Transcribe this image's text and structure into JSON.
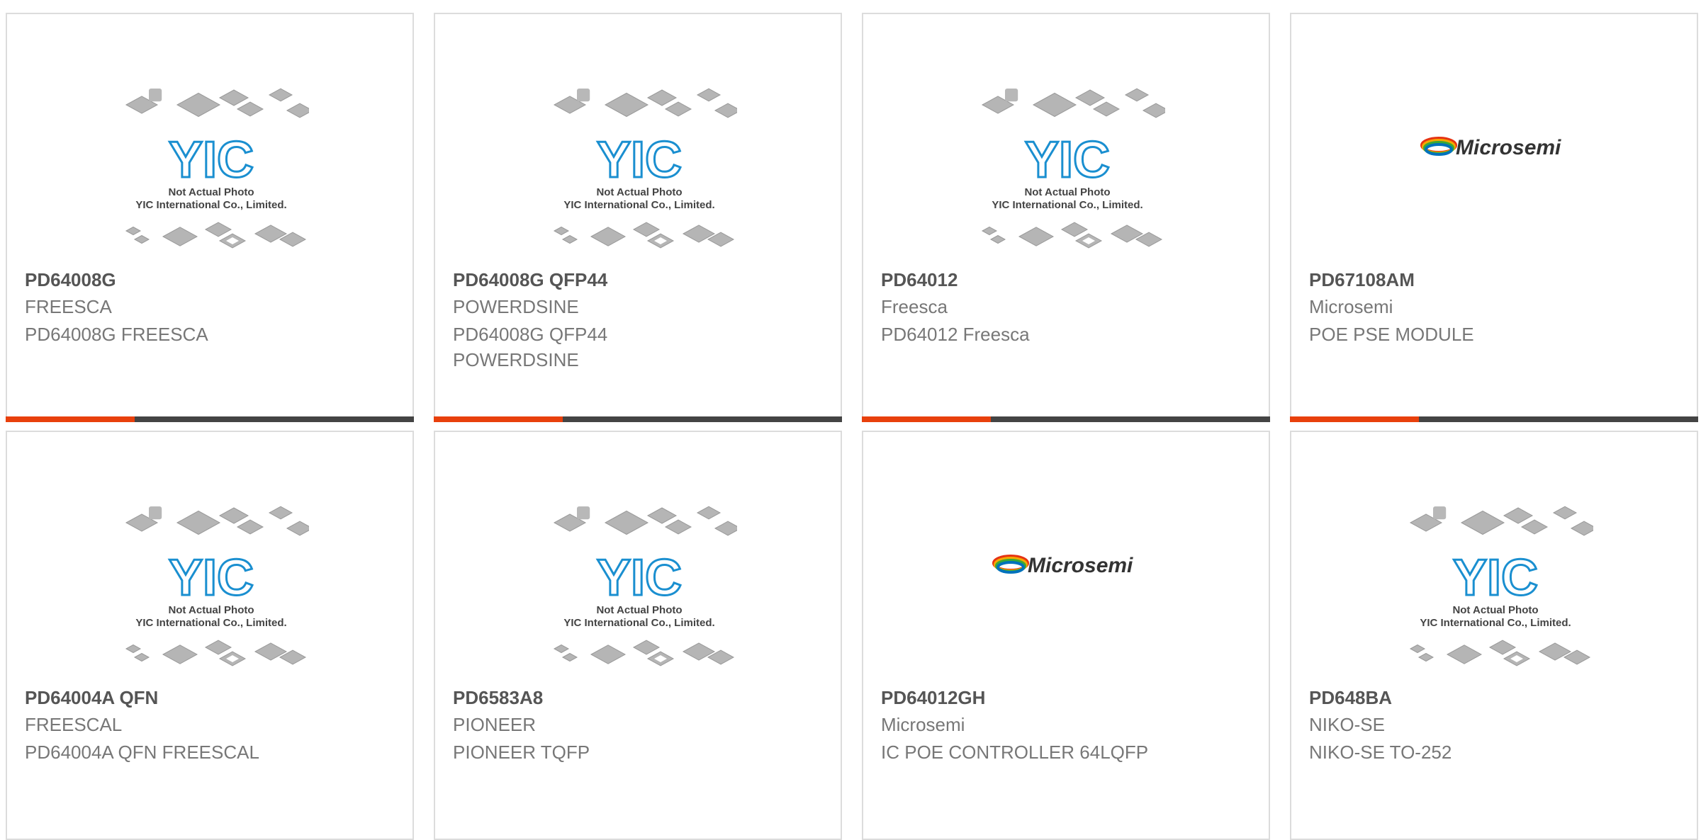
{
  "placeholder": {
    "brand": "YIC",
    "line1": "Not Actual Photo",
    "line2": "YIC International Co., Limited."
  },
  "microsemi_logo_text": "Microsemi",
  "colors": {
    "accent": "#e8400c",
    "bar": "#444444",
    "yic_blue": "#1a8fd0",
    "title": "#555555",
    "text": "#777777"
  },
  "cards": [
    {
      "part": "PD64008G",
      "manufacturer": "FREESCA",
      "description": "PD64008G FREESCA",
      "image": "yic-placeholder"
    },
    {
      "part": "PD64008G QFP44",
      "manufacturer": "POWERDSINE",
      "description": "PD64008G QFP44 POWERDSINE",
      "image": "yic-placeholder"
    },
    {
      "part": "PD64012",
      "manufacturer": "Freesca",
      "description": "PD64012 Freesca",
      "image": "yic-placeholder"
    },
    {
      "part": "PD67108AM",
      "manufacturer": "Microsemi",
      "description": "POE PSE MODULE",
      "image": "microsemi-logo"
    },
    {
      "part": "PD64004A QFN",
      "manufacturer": "FREESCAL",
      "description": "PD64004A QFN FREESCAL",
      "image": "yic-placeholder"
    },
    {
      "part": "PD6583A8",
      "manufacturer": "PIONEER",
      "description": "PIONEER TQFP",
      "image": "yic-placeholder"
    },
    {
      "part": "PD64012GH",
      "manufacturer": "Microsemi",
      "description": "IC POE CONTROLLER 64LQFP",
      "image": "microsemi-logo"
    },
    {
      "part": "PD648BA",
      "manufacturer": "NIKO-SE",
      "description": "NIKO-SE TO-252",
      "image": "yic-placeholder"
    }
  ]
}
